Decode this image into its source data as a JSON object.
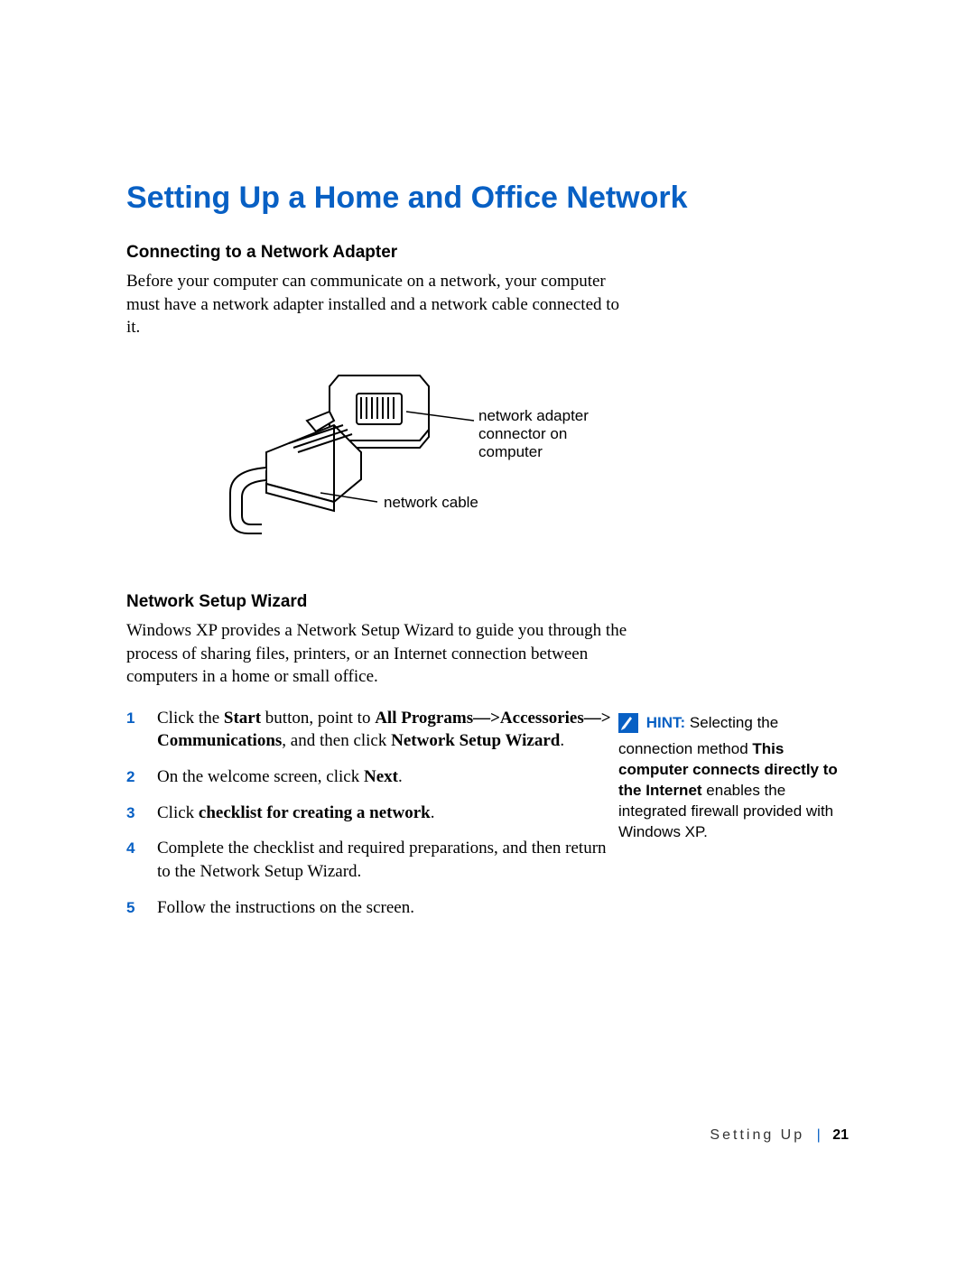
{
  "title": "Setting Up a Home and Office Network",
  "section1": {
    "heading": "Connecting to a Network Adapter",
    "body": "Before your computer can communicate on a network, your computer must have a network adapter installed and a network cable connected to it."
  },
  "figure": {
    "label_adapter_l1": "network adapter",
    "label_adapter_l2": "connector on",
    "label_adapter_l3": "computer",
    "label_cable": "network cable"
  },
  "section2": {
    "heading": "Network Setup Wizard",
    "body": "Windows XP provides a Network Setup Wizard to guide you through the process of sharing files, printers, or an Internet connection between computers in a home or small office."
  },
  "steps": {
    "n1": "1",
    "s1a": "Click the ",
    "s1b": "Start",
    "s1c": " button, point to ",
    "s1d": "All Programs—>Accessories—> Communications",
    "s1e": ", and then click ",
    "s1f": "Network Setup Wizard",
    "s1g": ".",
    "n2": "2",
    "s2a": "On the welcome screen, click ",
    "s2b": "Next",
    "s2c": ".",
    "n3": "3",
    "s3a": "Click ",
    "s3b": "checklist for creating a network",
    "s3c": ".",
    "n4": "4",
    "s4": "Complete the checklist and required preparations, and then return to the Network Setup Wizard.",
    "n5": "5",
    "s5": "Follow the instructions on the screen."
  },
  "hint": {
    "label": "HINT:",
    "t1": " Selecting the connection method ",
    "bold": "This computer connects directly to the Internet",
    "t2": " enables the integrated firewall provided with Windows XP."
  },
  "footer": {
    "section": "Setting Up",
    "sep": "|",
    "page": "21"
  }
}
